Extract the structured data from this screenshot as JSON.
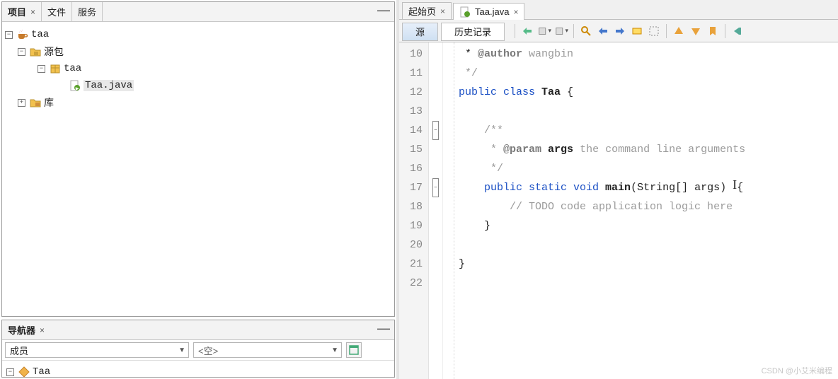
{
  "left": {
    "tabs": {
      "projects": "项目",
      "files": "文件",
      "services": "服务"
    },
    "tree": {
      "root": "taa",
      "src_pkg": "源包",
      "pkg": "taa",
      "file": "Taa.java",
      "libs": "库"
    }
  },
  "navigator": {
    "title": "导航器",
    "members": "成员",
    "empty": "<空>",
    "class": "Taa"
  },
  "editor": {
    "tabs": {
      "start": "起始页",
      "file": "Taa.java"
    },
    "subtabs": {
      "source": "源",
      "history": "历史记录"
    },
    "gutter_start": 10,
    "lines": [
      {
        "i": " * ",
        "t": [
          [
            "tag",
            "@author"
          ],
          [
            "cm",
            " wangbin"
          ]
        ]
      },
      {
        "i": " ",
        "t": [
          [
            "cm",
            "*/"
          ]
        ]
      },
      {
        "t": [
          [
            "kw",
            "public class "
          ],
          [
            "bold",
            "Taa"
          ],
          [
            "",
            " {"
          ]
        ]
      },
      {
        "t": [
          [
            "",
            ""
          ]
        ]
      },
      {
        "i": "    ",
        "t": [
          [
            "cm",
            "/**"
          ]
        ],
        "fold": "minus"
      },
      {
        "i": "    ",
        "t": [
          [
            "cm",
            " * "
          ],
          [
            "tag",
            "@param"
          ],
          [
            "bold",
            " args "
          ],
          [
            "cm",
            "the command line arguments"
          ]
        ]
      },
      {
        "i": "    ",
        "t": [
          [
            "cm",
            " */"
          ]
        ]
      },
      {
        "i": "    ",
        "t": [
          [
            "kw",
            "public static void "
          ],
          [
            "bold",
            "main"
          ],
          [
            "",
            "(String[] args) "
          ],
          [
            "cursor",
            ""
          ],
          [
            "",
            "{"
          ]
        ],
        "fold": "minus"
      },
      {
        "i": "        ",
        "t": [
          [
            "cm",
            "// TODO code application logic here"
          ]
        ]
      },
      {
        "i": "    ",
        "t": [
          [
            "",
            "}"
          ]
        ]
      },
      {
        "t": [
          [
            "",
            ""
          ]
        ]
      },
      {
        "t": [
          [
            "",
            "}"
          ]
        ]
      },
      {
        "t": [
          [
            "",
            ""
          ]
        ]
      }
    ]
  },
  "watermark": "CSDN @小艾米编程"
}
